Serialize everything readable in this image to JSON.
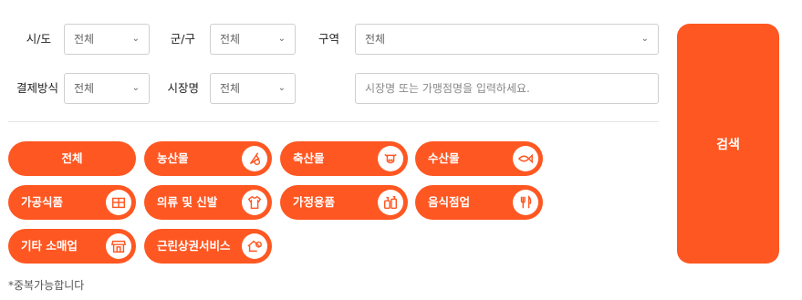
{
  "filters": {
    "sido": {
      "label": "시/도",
      "value": "전체"
    },
    "gungu": {
      "label": "군/구",
      "value": "전체"
    },
    "zone": {
      "label": "구역",
      "value": "전체"
    },
    "payment": {
      "label": "결제방식",
      "value": "전체"
    },
    "market": {
      "label": "시장명",
      "value": "전체"
    },
    "keyword": {
      "placeholder": "시장명 또는 가맹점명을 입력하세요."
    }
  },
  "search_label": "검색",
  "categories": [
    {
      "label": "전체",
      "icon": "none"
    },
    {
      "label": "농산물",
      "icon": "vegetable-icon"
    },
    {
      "label": "축산물",
      "icon": "cow-icon"
    },
    {
      "label": "수산물",
      "icon": "fish-icon"
    },
    {
      "label": "가공식품",
      "icon": "processed-food-icon"
    },
    {
      "label": "의류 및 신발",
      "icon": "shirt-icon"
    },
    {
      "label": "가정용품",
      "icon": "household-bottles-icon"
    },
    {
      "label": "음식점업",
      "icon": "fork-knife-icon"
    },
    {
      "label": "기타 소매업",
      "icon": "store-icon"
    },
    {
      "label": "근린상권서비스",
      "icon": "service-house-icon"
    }
  ],
  "note": "*중복가능합니다",
  "colors": {
    "accent": "#ff5722"
  }
}
